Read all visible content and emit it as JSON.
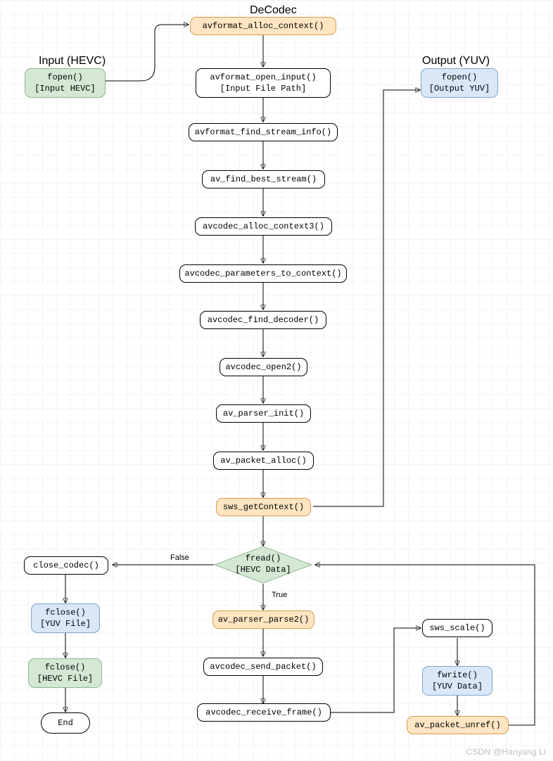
{
  "titles": {
    "decodec": "DeCodec",
    "input": "Input (HEVC)",
    "output": "Output (YUV)"
  },
  "nodes": {
    "input_fopen": "fopen()\n[Input HEVC]",
    "output_fopen": "fopen()\n[Output YUV]",
    "avformat_alloc": "avformat_alloc_context()",
    "avformat_open": "avformat_open_input()\n[Input File Path]",
    "find_stream": "avformat_find_stream_info()",
    "find_best": "av_find_best_stream()",
    "alloc_ctx3": "avcodec_alloc_context3()",
    "params_to_ctx": "avcodec_parameters_to_context()",
    "find_decoder": "avcodec_find_decoder()",
    "open2": "avcodec_open2()",
    "parser_init": "av_parser_init()",
    "packet_alloc": "av_packet_alloc()",
    "sws_getctx": "sws_getContext()",
    "fread": "fread()\n[HEVC Data]",
    "parser_parse2": "av_parser_parse2()",
    "send_packet": "avcodec_send_packet()",
    "receive_frame": "avcodec_receive_frame()",
    "sws_scale": "sws_scale()",
    "fwrite": "fwrite()\n[YUV Data]",
    "packet_unref": "av_packet_unref()",
    "close_codec": "close_codec()",
    "fclose_yuv": "fclose()\n[YUV File]",
    "fclose_hevc": "fclose()\n[HEVC File]",
    "end": "End"
  },
  "edge_labels": {
    "false": "False",
    "true": "True"
  },
  "watermark": "CSDN @Hanyang Li"
}
